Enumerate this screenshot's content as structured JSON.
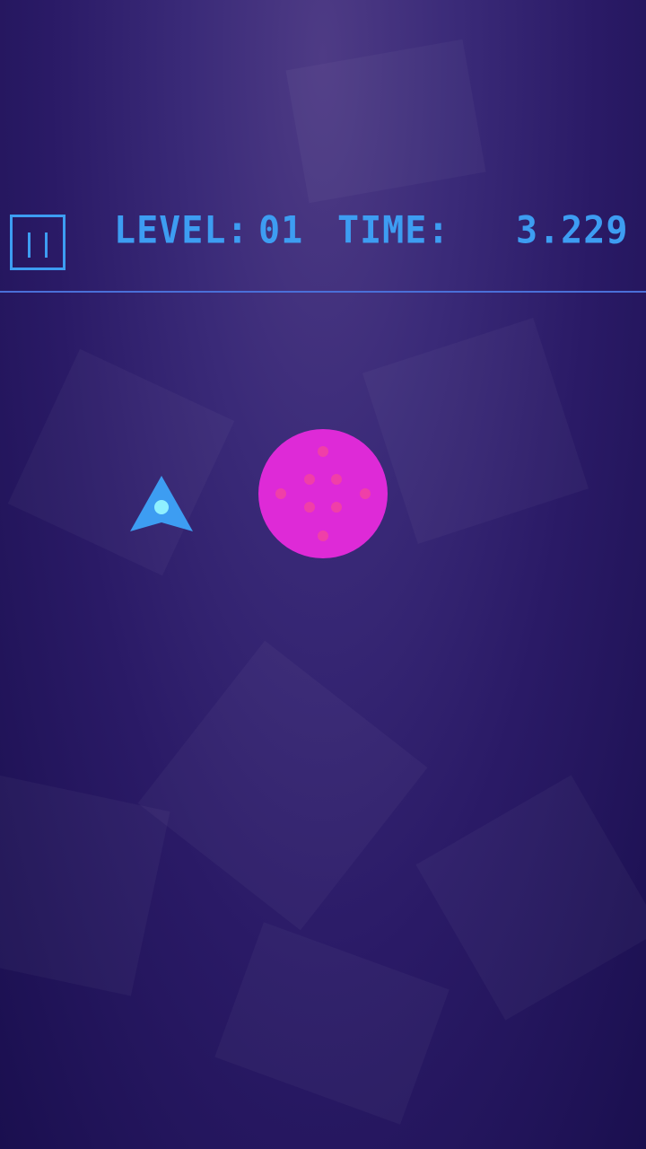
{
  "hud": {
    "level_label": "LEVEL:",
    "level_value": "01",
    "time_label": "TIME:",
    "time_value": "3.229"
  },
  "pause": {
    "icon": "pause-icon"
  },
  "player": {
    "icon": "arrow-ship-icon",
    "color": "#3d9df2",
    "core_color": "#8ff0ff"
  },
  "target": {
    "icon": "spotted-orb-icon",
    "color": "#de2ad7",
    "dot_color": "#f03fa8"
  },
  "colors": {
    "hud_accent": "#3d9df2",
    "divider": "#4a6fd8"
  }
}
